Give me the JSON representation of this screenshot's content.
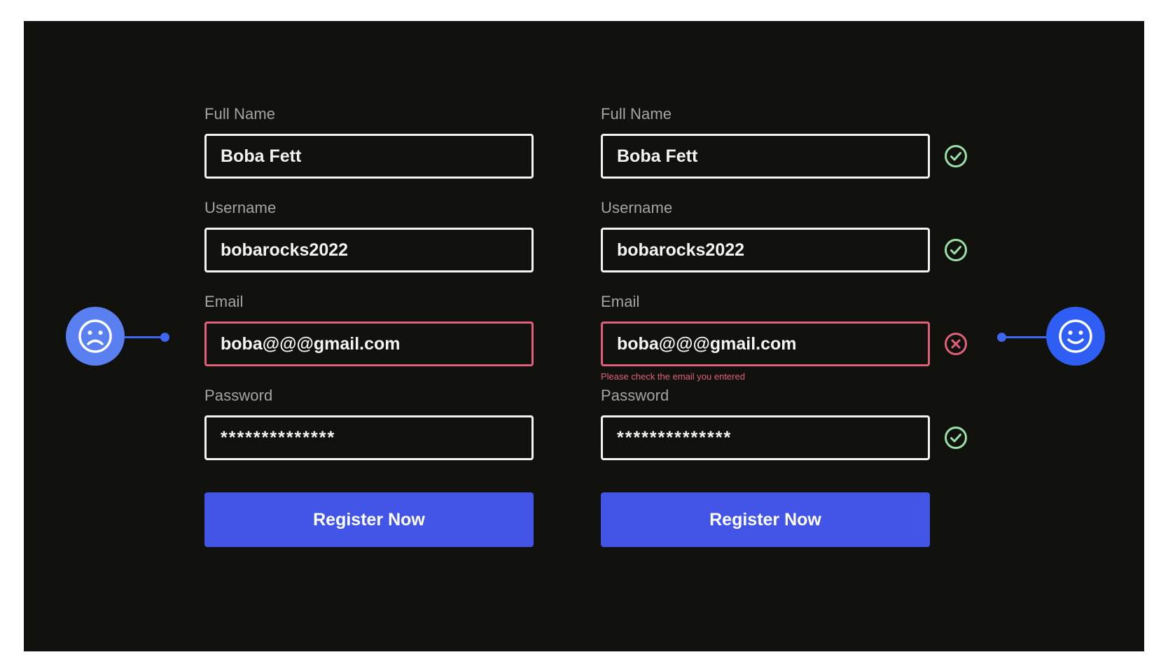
{
  "forms": [
    {
      "full_name_label": "Full Name",
      "full_name_value": "Boba Fett",
      "username_label": "Username",
      "username_value": "bobarocks2022",
      "email_label": "Email",
      "email_value": "boba@@@gmail.com",
      "password_label": "Password",
      "password_value": "**************",
      "button_label": "Register Now"
    },
    {
      "full_name_label": "Full Name",
      "full_name_value": "Boba Fett",
      "username_label": "Username",
      "username_value": "bobarocks2022",
      "email_label": "Email",
      "email_value": "boba@@@gmail.com",
      "email_error": "Please check the email you entered",
      "password_label": "Password",
      "password_value": "**************",
      "button_label": "Register Now"
    }
  ],
  "icons": {
    "left_mood": "sad-face-icon",
    "right_mood": "happy-face-icon",
    "valid": "check-circle-icon",
    "invalid": "x-circle-icon"
  },
  "colors": {
    "background": "#11110d",
    "text": "#f4f4f2",
    "label": "#a5a5a2",
    "error": "#e0607a",
    "success": "#9be0a8",
    "button": "#4255e6",
    "sad_circle": "#5a7ff0",
    "happy_circle": "#2f5ef5"
  }
}
